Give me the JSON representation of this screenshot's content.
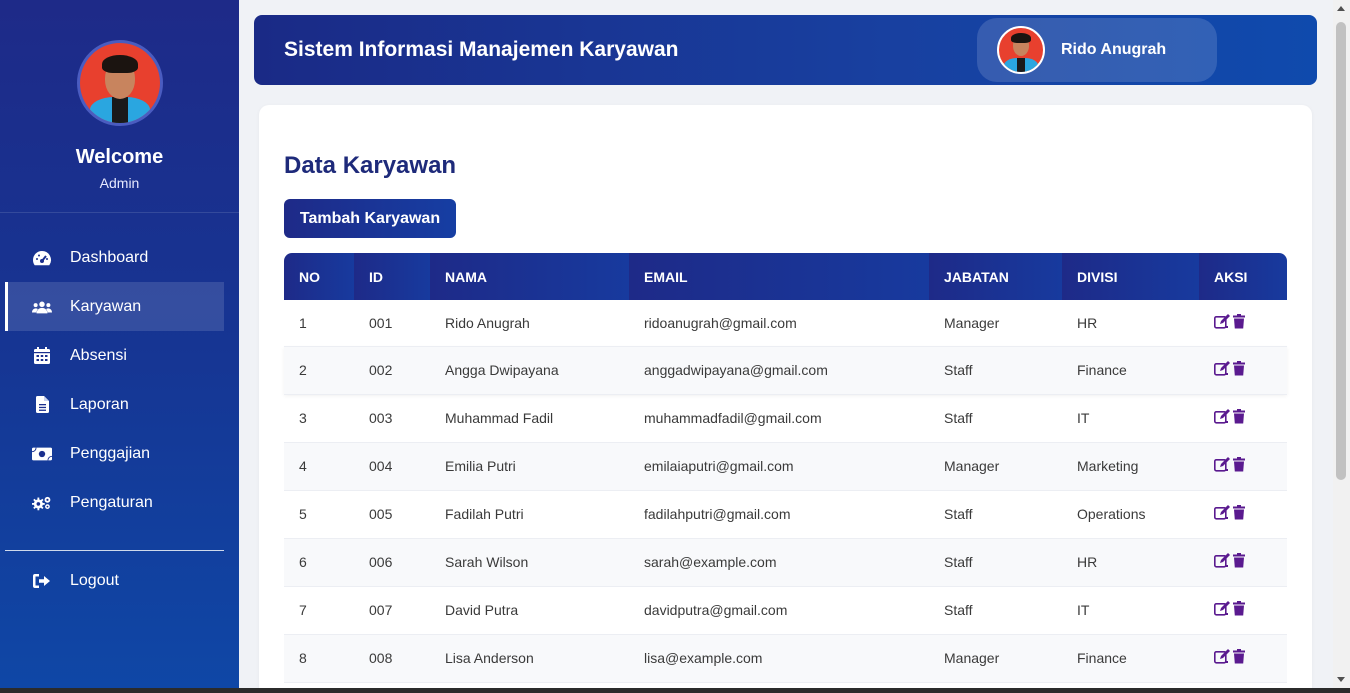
{
  "sidebar": {
    "welcome": "Welcome",
    "role": "Admin",
    "menu": [
      {
        "label": "Dashboard",
        "icon": "tachometer-icon"
      },
      {
        "label": "Karyawan",
        "icon": "users-icon",
        "active": true
      },
      {
        "label": "Absensi",
        "icon": "calendar-icon"
      },
      {
        "label": "Laporan",
        "icon": "file-icon"
      },
      {
        "label": "Penggajian",
        "icon": "money-icon"
      },
      {
        "label": "Pengaturan",
        "icon": "gears-icon"
      }
    ],
    "logout": "Logout"
  },
  "header": {
    "title": "Sistem Informasi Manajemen Karyawan",
    "user_name": "Rido Anugrah"
  },
  "main": {
    "title": "Data Karyawan",
    "add_button": "Tambah Karyawan",
    "columns": [
      "NO",
      "ID",
      "NAMA",
      "EMAIL",
      "JABATAN",
      "DIVISI",
      "AKSI"
    ],
    "rows": [
      {
        "no": "1",
        "id": "001",
        "nama": "Rido Anugrah",
        "email": "ridoanugrah@gmail.com",
        "jabatan": "Manager",
        "divisi": "HR"
      },
      {
        "no": "2",
        "id": "002",
        "nama": "Angga Dwipayana",
        "email": "anggadwipayana@gmail.com",
        "jabatan": "Staff",
        "divisi": "Finance"
      },
      {
        "no": "3",
        "id": "003",
        "nama": "Muhammad Fadil",
        "email": "muhammadfadil@gmail.com",
        "jabatan": "Staff",
        "divisi": "IT"
      },
      {
        "no": "4",
        "id": "004",
        "nama": "Emilia Putri",
        "email": "emilaiaputri@gmail.com",
        "jabatan": "Manager",
        "divisi": "Marketing"
      },
      {
        "no": "5",
        "id": "005",
        "nama": "Fadilah Putri",
        "email": "fadilahputri@gmail.com",
        "jabatan": "Staff",
        "divisi": "Operations"
      },
      {
        "no": "6",
        "id": "006",
        "nama": "Sarah Wilson",
        "email": "sarah@example.com",
        "jabatan": "Staff",
        "divisi": "HR"
      },
      {
        "no": "7",
        "id": "007",
        "nama": "David Putra",
        "email": "davidputra@gmail.com",
        "jabatan": "Staff",
        "divisi": "IT"
      },
      {
        "no": "8",
        "id": "008",
        "nama": "Lisa Anderson",
        "email": "lisa@example.com",
        "jabatan": "Manager",
        "divisi": "Finance"
      }
    ],
    "action_icons": [
      "edit-icon",
      "trash-icon"
    ]
  },
  "colors": {
    "primary": "#1e2a88",
    "title": "#1e2a7a",
    "action": "#5a1a8f"
  }
}
